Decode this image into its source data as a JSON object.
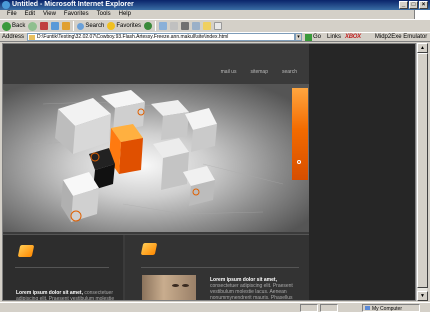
{
  "window": {
    "title": "Untitled - Microsoft Internet Explorer",
    "controls": [
      "_",
      "□",
      "×"
    ]
  },
  "menu": [
    "File",
    "Edit",
    "View",
    "Favorites",
    "Tools",
    "Help"
  ],
  "toolbar": {
    "back_label": "Back",
    "search_label": "Search",
    "favorites_label": "Favorites"
  },
  "address_bar": {
    "label": "Address",
    "value": "D:\\Funtik\\Testing\\32.02.07\\Cowboy.93.Flash.Artessy.Freeze.ann.makull\\site\\index.html",
    "go_label": "Go",
    "links_label": "Links",
    "xbox_label": "XBOX",
    "emulator_label": "Midp2Exe Emulator"
  },
  "site": {
    "nav": [
      "mail us",
      "sitemap",
      "search"
    ],
    "col1_text_bold": "Lorem ipsum dolor sit amet,",
    "col1_text": " consectetuer adipiscing elit. Praesent vestibulum molestie",
    "col2_text_bold": "Lorem ipsum dolor sit amet,",
    "col2_text": " consectetuer adipiscing elit. Praesent vestibulum molestie lacus. Aenean nonummynendrerit mauris. Phasellus porta. Fusce suscipit viverrienties,"
  },
  "status": {
    "zone": "My Computer"
  },
  "colors": {
    "accent_orange": "#f36b00",
    "page_bg": "#262626",
    "chrome": "#d4d0c8"
  }
}
